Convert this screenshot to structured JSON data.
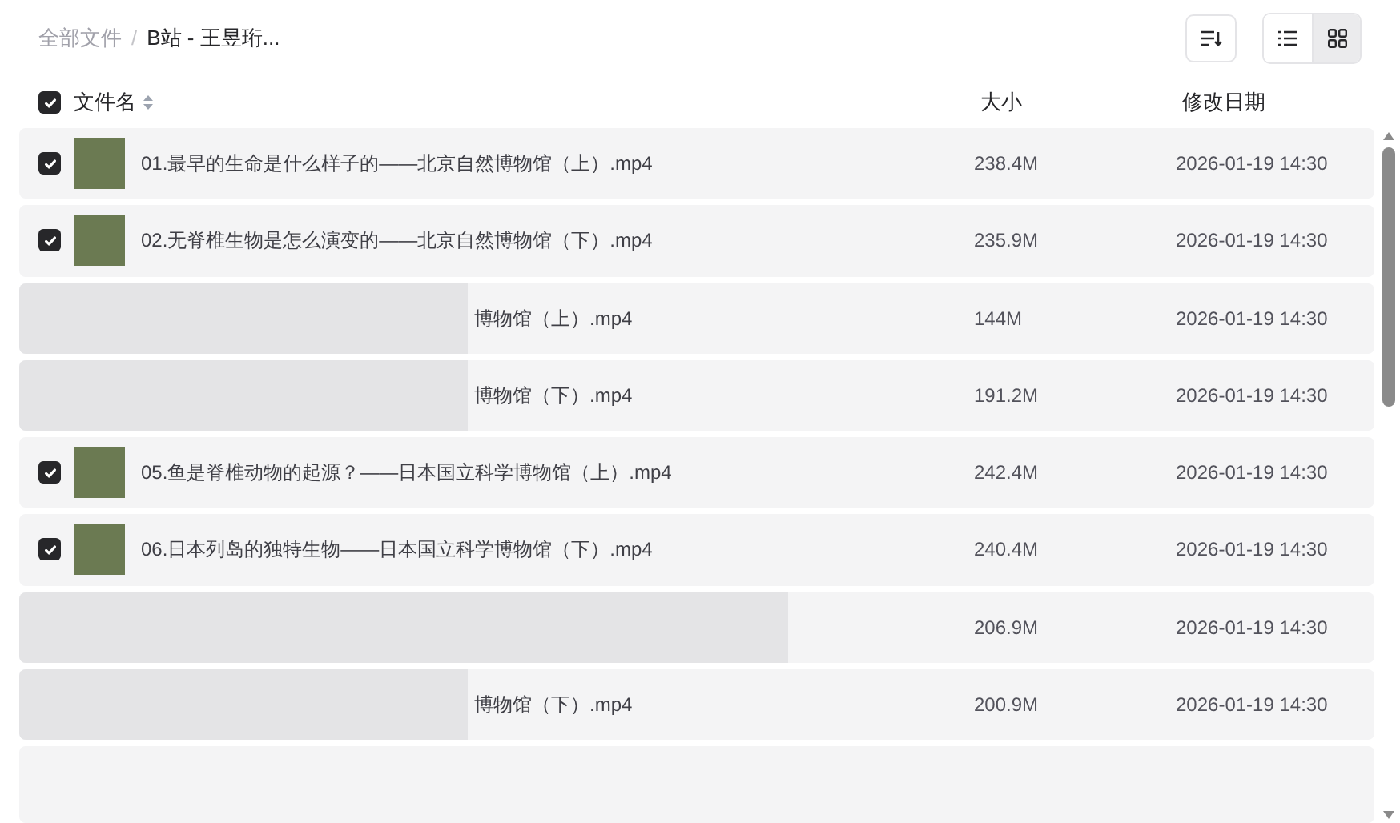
{
  "breadcrumb": {
    "root": "全部文件",
    "separator": "/",
    "current": "B站 - 王昱珩..."
  },
  "toolbar": {
    "view_modes": [
      {
        "kind": "list",
        "selected": true
      },
      {
        "kind": "grid",
        "selected": false
      }
    ]
  },
  "header": {
    "select_all": {
      "checked": true
    },
    "columns": [
      "文件名",
      "大小",
      "修改日期"
    ]
  },
  "rows": [
    {
      "kind": "plain",
      "checked": true,
      "name": "01.最早的生命是什么样子的——北京自然博物馆（上）.mp4",
      "size": "238.4M",
      "modified": "2026-01-19 14:30"
    },
    {
      "kind": "plain",
      "checked": true,
      "name": "02.无脊椎生物是怎么演变的——北京自然博物馆（下）.mp4",
      "size": "235.9M",
      "modified": "2026-01-19 14:30"
    },
    {
      "kind": "blurred",
      "name": "博物馆（上）.mp4",
      "size": "144M",
      "modified": "2026-01-19 14:30"
    },
    {
      "kind": "blurred",
      "name": "博物馆（下）.mp4",
      "size": "191.2M",
      "modified": "2026-01-19 14:30"
    },
    {
      "kind": "plain",
      "checked": true,
      "name": "05.鱼是脊椎动物的起源？——日本国立科学博物馆（上）.mp4",
      "size": "242.4M",
      "modified": "2026-01-19 14:30"
    },
    {
      "kind": "plain",
      "checked": true,
      "name": "06.日本列岛的独特生物——日本国立科学博物馆（下）.mp4",
      "size": "240.4M",
      "modified": "2026-01-19 14:30"
    },
    {
      "kind": "hidden",
      "size": "206.9M",
      "modified": "2026-01-19 14:30"
    },
    {
      "kind": "blurred",
      "name": "博物馆（下）.mp4",
      "size": "200.9M",
      "modified": "2026-01-19 14:30"
    }
  ]
}
